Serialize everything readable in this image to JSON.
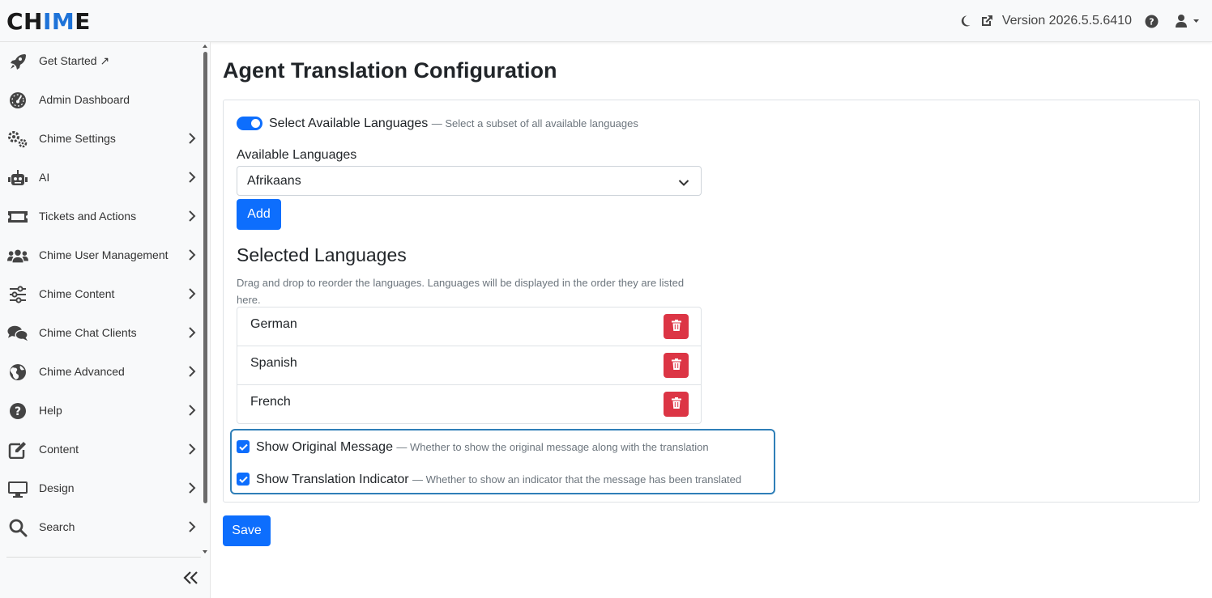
{
  "header": {
    "logo_prefix": "CH",
    "logo_accent": "IM",
    "logo_suffix": "E",
    "version": "Version 2026.5.5.6410"
  },
  "sidebar": {
    "items": [
      {
        "label": "Get Started ↗",
        "icon": "rocket-icon",
        "has_chevron": false
      },
      {
        "label": "Admin Dashboard",
        "icon": "gauge-icon",
        "has_chevron": false
      },
      {
        "label": "Chime Settings",
        "icon": "gears-icon",
        "has_chevron": true
      },
      {
        "label": "AI",
        "icon": "robot-icon",
        "has_chevron": true
      },
      {
        "label": "Tickets and Actions",
        "icon": "ticket-icon",
        "has_chevron": true
      },
      {
        "label": "Chime User Management",
        "icon": "users-icon",
        "has_chevron": true
      },
      {
        "label": "Chime Content",
        "icon": "sliders-icon",
        "has_chevron": true
      },
      {
        "label": "Chime Chat Clients",
        "icon": "comments-icon",
        "has_chevron": true
      },
      {
        "label": "Chime Advanced",
        "icon": "globe-icon",
        "has_chevron": true
      },
      {
        "label": "Help",
        "icon": "question-circle-icon",
        "has_chevron": true
      },
      {
        "label": "Content",
        "icon": "edit-icon",
        "has_chevron": true
      },
      {
        "label": "Design",
        "icon": "desktop-icon",
        "has_chevron": true
      },
      {
        "label": "Search",
        "icon": "search-icon",
        "has_chevron": true
      }
    ]
  },
  "main": {
    "title": "Agent Translation Configuration",
    "select_languages": {
      "label": "Select Available Languages",
      "description": "— Select a subset of all available languages",
      "enabled": true
    },
    "available_languages": {
      "label": "Available Languages",
      "selected": "Afrikaans",
      "add_label": "Add"
    },
    "selected_languages": {
      "title": "Selected Languages",
      "help": "Drag and drop to reorder the languages. Languages will be displayed in the order they are listed here.",
      "items": [
        "German",
        "Spanish",
        "French"
      ]
    },
    "options": [
      {
        "label": "Show Original Message",
        "description": "— Whether to show the original message along with the translation",
        "checked": true
      },
      {
        "label": "Show Translation Indicator",
        "description": "— Whether to show an indicator that the message has been translated",
        "checked": true
      }
    ],
    "save_label": "Save"
  },
  "colors": {
    "primary": "#0d6efd",
    "danger": "#dc3545",
    "logo_accent": "#1e73d8",
    "highlight": "#2f7fb8"
  }
}
